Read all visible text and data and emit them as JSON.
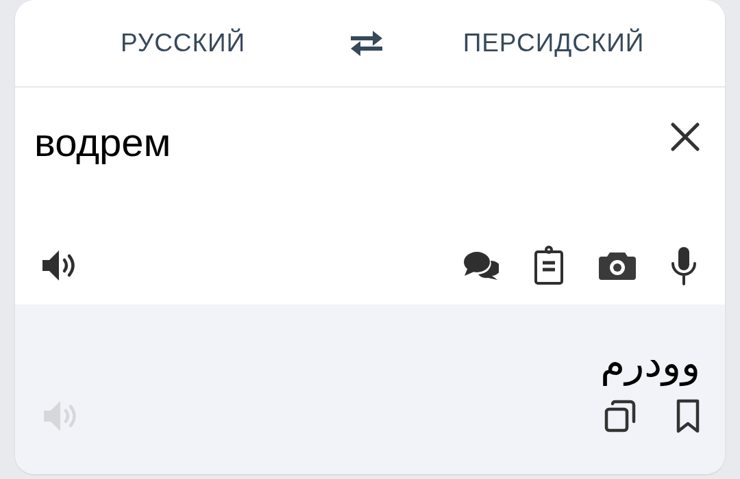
{
  "languages": {
    "source": "РУССКИЙ",
    "target": "ПЕРСИДСКИЙ"
  },
  "input": {
    "value": "водрем"
  },
  "output": {
    "text": "وودرم",
    "speaker_disabled": true
  }
}
